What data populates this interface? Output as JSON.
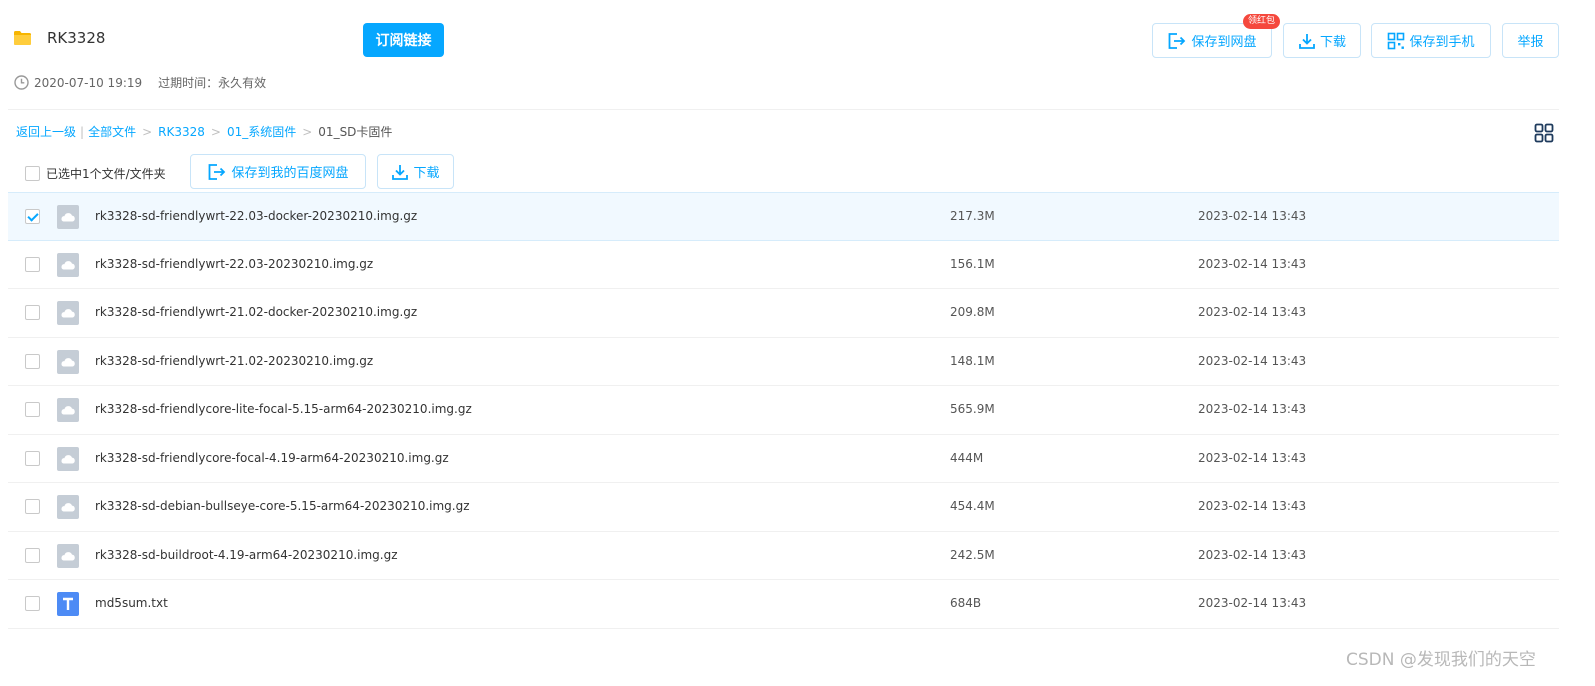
{
  "share": {
    "title": "RK3328",
    "subscribe_label": "订阅链接",
    "created_time": "2020-07-10 19:19",
    "expire_label": "过期时间：",
    "expire_value": "永久有效"
  },
  "actions": {
    "save_to_pan": "保存到网盘",
    "save_badge": "领红包",
    "download": "下载",
    "save_to_phone": "保存到手机",
    "report": "举报"
  },
  "breadcrumb": {
    "back": "返回上一级",
    "all_files": "全部文件",
    "path": [
      "RK3328",
      "01_系统固件"
    ],
    "current": "01_SD卡固件"
  },
  "toolbar": {
    "selection_text": "已选中1个文件/文件夹",
    "save_to_my_pan": "保存到我的百度网盘",
    "download": "下载"
  },
  "files": [
    {
      "name": "rk3328-sd-friendlywrt-22.03-docker-20230210.img.gz",
      "size": "217.3M",
      "date": "2023-02-14 13:43",
      "checked": true,
      "icon": "archive-file-icon"
    },
    {
      "name": "rk3328-sd-friendlywrt-22.03-20230210.img.gz",
      "size": "156.1M",
      "date": "2023-02-14 13:43",
      "checked": false,
      "icon": "archive-file-icon"
    },
    {
      "name": "rk3328-sd-friendlywrt-21.02-docker-20230210.img.gz",
      "size": "209.8M",
      "date": "2023-02-14 13:43",
      "checked": false,
      "icon": "archive-file-icon"
    },
    {
      "name": "rk3328-sd-friendlywrt-21.02-20230210.img.gz",
      "size": "148.1M",
      "date": "2023-02-14 13:43",
      "checked": false,
      "icon": "archive-file-icon"
    },
    {
      "name": "rk3328-sd-friendlycore-lite-focal-5.15-arm64-20230210.img.gz",
      "size": "565.9M",
      "date": "2023-02-14 13:43",
      "checked": false,
      "icon": "archive-file-icon"
    },
    {
      "name": "rk3328-sd-friendlycore-focal-4.19-arm64-20230210.img.gz",
      "size": "444M",
      "date": "2023-02-14 13:43",
      "checked": false,
      "icon": "archive-file-icon"
    },
    {
      "name": "rk3328-sd-debian-bullseye-core-5.15-arm64-20230210.img.gz",
      "size": "454.4M",
      "date": "2023-02-14 13:43",
      "checked": false,
      "icon": "archive-file-icon"
    },
    {
      "name": "rk3328-sd-buildroot-4.19-arm64-20230210.img.gz",
      "size": "242.5M",
      "date": "2023-02-14 13:43",
      "checked": false,
      "icon": "archive-file-icon"
    },
    {
      "name": "md5sum.txt",
      "size": "684B",
      "date": "2023-02-14 13:43",
      "checked": false,
      "icon": "text-file-icon"
    }
  ],
  "watermark": "CSDN @发现我们的天空",
  "colors": {
    "accent": "#06a7ff",
    "badge": "#f5483d",
    "archive_icon": "#c5cdd6",
    "text_icon": "#4d8bf5"
  }
}
